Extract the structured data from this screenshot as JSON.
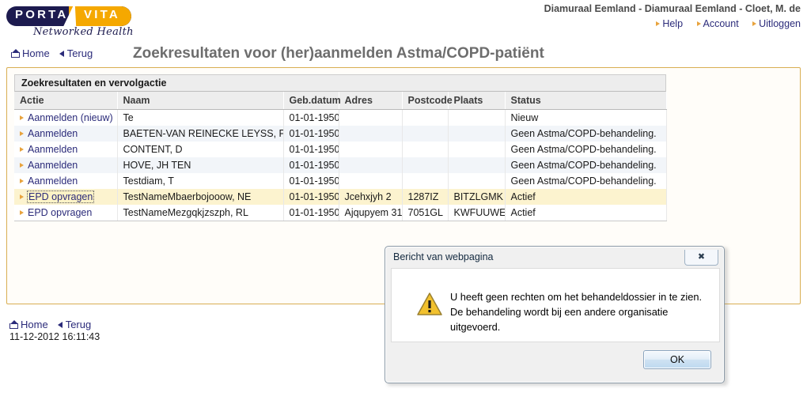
{
  "brand": {
    "name_left": "PORTA",
    "name_right": "VITA",
    "tagline": "Networked Health"
  },
  "header": {
    "user_line": "Diamuraal Eemland - Diamuraal Eemland - Cloet, M. de",
    "links": [
      {
        "label": "Help"
      },
      {
        "label": "Account"
      },
      {
        "label": "Uitloggen"
      }
    ]
  },
  "nav": {
    "home": "Home",
    "back": "Terug"
  },
  "page_title": "Zoekresultaten voor (her)aanmelden Astma/COPD-patiënt",
  "panel": {
    "block_title": "Zoekresultaten en vervolgactie",
    "columns": [
      "Actie",
      "Naam",
      "Geb.datum",
      "Adres",
      "Postcode",
      "Plaats",
      "Status"
    ],
    "rows": [
      {
        "action": "Aanmelden (nieuw)",
        "naam": "Te",
        "geb": "01-01-1950",
        "adres": "",
        "postcode": "",
        "plaats": "",
        "status": "Nieuw",
        "focused": false
      },
      {
        "action": "Aanmelden",
        "naam": "BAETEN-VAN REINECKE LEYSS, PM",
        "geb": "01-01-1950",
        "adres": "",
        "postcode": "",
        "plaats": "",
        "status": "Geen Astma/COPD-behandeling.",
        "focused": false
      },
      {
        "action": "Aanmelden",
        "naam": "CONTENT, D",
        "geb": "01-01-1950",
        "adres": "",
        "postcode": "",
        "plaats": "",
        "status": "Geen Astma/COPD-behandeling.",
        "focused": false
      },
      {
        "action": "Aanmelden",
        "naam": "HOVE, JH TEN",
        "geb": "01-01-1950",
        "adres": "",
        "postcode": "",
        "plaats": "",
        "status": "Geen Astma/COPD-behandeling.",
        "focused": false
      },
      {
        "action": "Aanmelden",
        "naam": "Testdiam, T",
        "geb": "01-01-1950",
        "adres": "",
        "postcode": "",
        "plaats": "",
        "status": "Geen Astma/COPD-behandeling.",
        "focused": false
      },
      {
        "action": "EPD opvragen",
        "naam": "TestNameMbaerbojooow, NE",
        "geb": "01-01-1950",
        "adres": "Jcehxjyh 2",
        "postcode": "1287IZ",
        "plaats": "BITZLGMK",
        "status": "Actief",
        "focused": true
      },
      {
        "action": "EPD opvragen",
        "naam": "TestNameMezgqkjzszph, RL",
        "geb": "01-01-1950",
        "adres": "Ajqupyem 31",
        "postcode": "7051GL",
        "plaats": "KWFUUWEJ",
        "status": "Actief",
        "focused": false
      }
    ]
  },
  "footer": {
    "home": "Home",
    "back": "Terug",
    "timestamp": "11-12-2012 16:11:43"
  },
  "dialog": {
    "title": "Bericht van webpagina",
    "close_glyph": "✖",
    "message": "U heeft geen rechten om het behandeldossier in te zien. De behandeling wordt bij een andere organisatie uitgevoerd.",
    "ok_label": "OK"
  },
  "colors": {
    "brand_navy": "#1d1b4f",
    "brand_orange": "#f5a800",
    "panel_border": "#d9ae52",
    "link": "#2b2b7a",
    "selected_row": "#fcf3cf"
  }
}
